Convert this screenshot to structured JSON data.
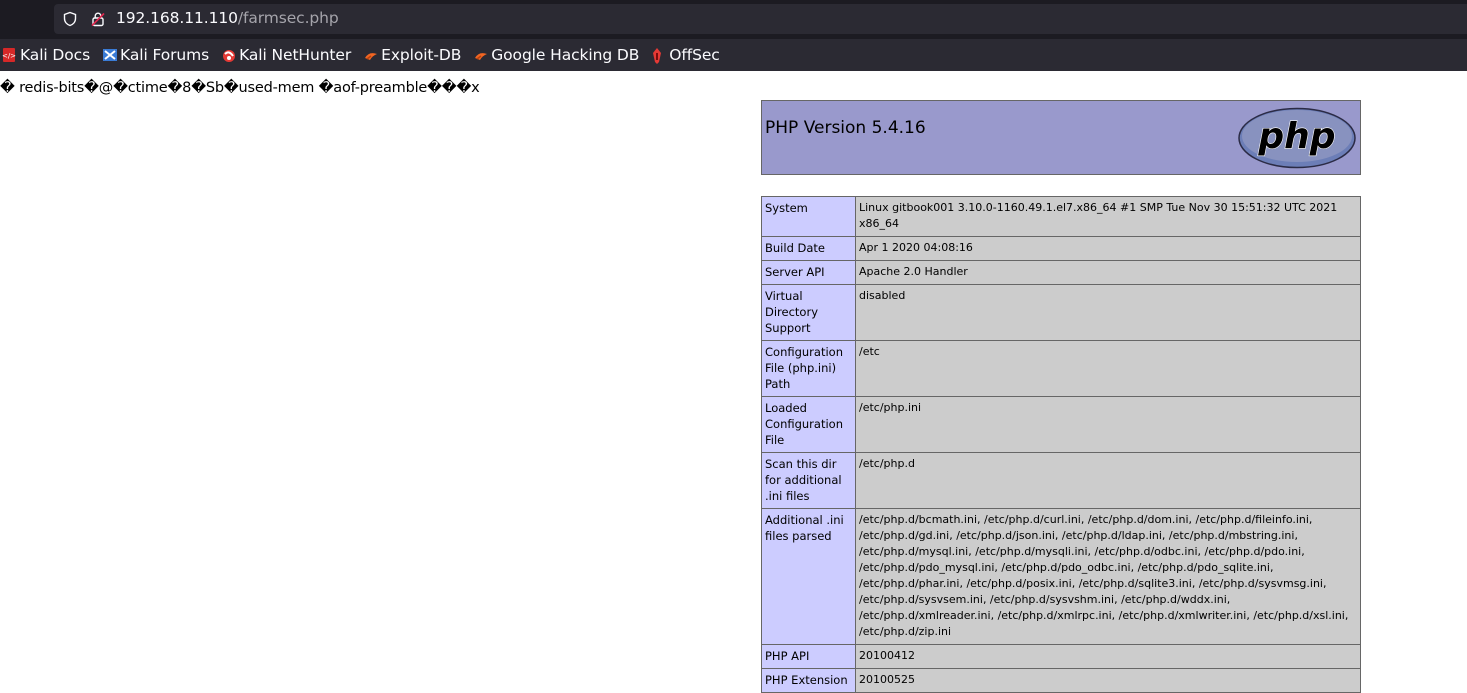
{
  "browser": {
    "url_host": "192.168.11.110",
    "url_path": "/farmsec.php",
    "bookmarks": [
      {
        "label": "Kali Docs",
        "icon": "kali-docs-icon"
      },
      {
        "label": "Kali Forums",
        "icon": "kali-forums-icon"
      },
      {
        "label": "Kali NetHunter",
        "icon": "nethunter-icon"
      },
      {
        "label": "Exploit-DB",
        "icon": "exploit-db-icon"
      },
      {
        "label": "Google Hacking DB",
        "icon": "ghdb-icon"
      },
      {
        "label": "OffSec",
        "icon": "offsec-icon"
      }
    ]
  },
  "page": {
    "garbage_text": "� redis-bits�@�ctime�8�Sb�used-mem �aof-preamble���x",
    "php_version": "PHP Version 5.4.16",
    "logo_text": "php",
    "rows": [
      {
        "key": "System",
        "value": "Linux gitbook001 3.10.0-1160.49.1.el7.x86_64 #1 SMP Tue Nov 30 15:51:32 UTC 2021 x86_64"
      },
      {
        "key": "Build Date",
        "value": "Apr 1 2020 04:08:16"
      },
      {
        "key": "Server API",
        "value": "Apache 2.0 Handler"
      },
      {
        "key": "Virtual Directory Support",
        "value": "disabled"
      },
      {
        "key": "Configuration File (php.ini) Path",
        "value": "/etc"
      },
      {
        "key": "Loaded Configuration File",
        "value": "/etc/php.ini"
      },
      {
        "key": "Scan this dir for additional .ini files",
        "value": "/etc/php.d"
      },
      {
        "key": "Additional .ini files parsed",
        "value": "/etc/php.d/bcmath.ini, /etc/php.d/curl.ini, /etc/php.d/dom.ini, /etc/php.d/fileinfo.ini, /etc/php.d/gd.ini, /etc/php.d/json.ini, /etc/php.d/ldap.ini, /etc/php.d/mbstring.ini, /etc/php.d/mysql.ini, /etc/php.d/mysqli.ini, /etc/php.d/odbc.ini, /etc/php.d/pdo.ini, /etc/php.d/pdo_mysql.ini, /etc/php.d/pdo_odbc.ini, /etc/php.d/pdo_sqlite.ini, /etc/php.d/phar.ini, /etc/php.d/posix.ini, /etc/php.d/sqlite3.ini, /etc/php.d/sysvmsg.ini, /etc/php.d/sysvsem.ini, /etc/php.d/sysvshm.ini, /etc/php.d/wddx.ini, /etc/php.d/xmlreader.ini, /etc/php.d/xmlrpc.ini, /etc/php.d/xmlwriter.ini, /etc/php.d/xsl.ini, /etc/php.d/zip.ini"
      },
      {
        "key": "PHP API",
        "value": "20100412"
      },
      {
        "key": "PHP Extension",
        "value": "20100525"
      }
    ]
  },
  "colors": {
    "header_bg": "#9999cc",
    "key_bg": "#ccccff",
    "value_bg": "#cccccc",
    "chrome_bg": "#2b2a33"
  }
}
